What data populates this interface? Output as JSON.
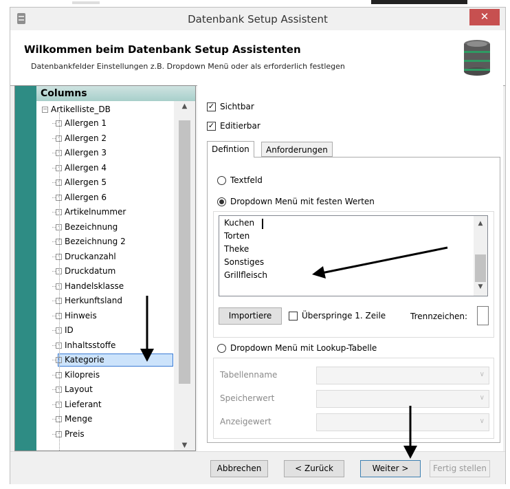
{
  "window": {
    "title": "Datenbank Setup Assistent",
    "close_glyph": "✕"
  },
  "header": {
    "title": "Wilkommen beim Datenbank Setup Assistenten",
    "subtitle": "Datenbankfelder Einstellungen z.B. Dropdown Menü oder als erforderlich festlegen",
    "icon": "database-icon"
  },
  "left_panel": {
    "header": "Columns",
    "root": "Artikelliste_DB",
    "items": [
      "Allergen 1",
      "Allergen 2",
      "Allergen 3",
      "Allergen 4",
      "Allergen 5",
      "Allergen 6",
      "Artikelnummer",
      "Bezeichnung",
      "Bezeichnung 2",
      "Druckanzahl",
      "Druckdatum",
      "Handelsklasse",
      "Herkunftsland",
      "Hinweis",
      "ID",
      "Inhaltsstoffe",
      "Kategorie",
      "Kilopreis",
      "Layout",
      "Lieferant",
      "Menge",
      "Preis"
    ],
    "selected": "Kategorie"
  },
  "options": {
    "visible_label": "Sichtbar",
    "visible_checked": true,
    "editable_label": "Editierbar",
    "editable_checked": true
  },
  "tabs": [
    {
      "label": "Defintion",
      "active": true
    },
    {
      "label": "Anforderungen",
      "active": false
    }
  ],
  "definition": {
    "radio_textfield": "Textfeld",
    "radio_dropdown_fixed": "Dropdown Menü mit festen Werten",
    "radio_dropdown_lookup": "Dropdown Menü mit Lookup-Tabelle",
    "selected_option": "Dropdown Menü mit festen Werten",
    "fixed_values": [
      "Kuchen",
      "Torten",
      "Theke",
      "Sonstiges",
      "Grillfleisch"
    ],
    "import_button": "Importiere",
    "skip_first_row_label": "Überspringe 1. Zeile",
    "skip_first_row_checked": false,
    "separator_label": "Trennzeichen:",
    "separator_value": ""
  },
  "lookup": {
    "table_name_label": "Tabellenname",
    "store_value_label": "Speicherwert",
    "display_value_label": "Anzeigewert"
  },
  "footer": {
    "cancel": "Abbrechen",
    "back": "< Zurück",
    "next": "Weiter >",
    "finish": "Fertig stellen"
  },
  "colors": {
    "accent_teal": "#2e8c84",
    "close_red": "#c75050",
    "selection": "#cce3fb"
  }
}
